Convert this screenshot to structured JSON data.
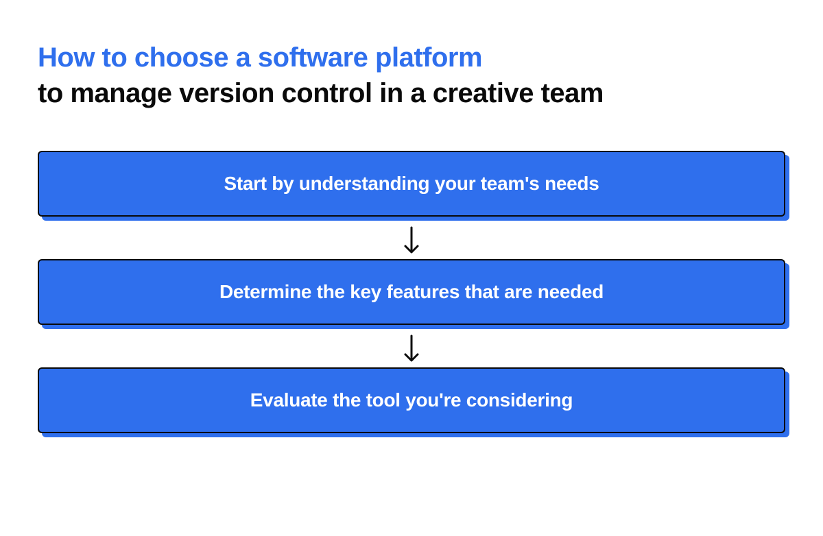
{
  "title": {
    "line1": "How to choose a software platform",
    "line2": "to manage version control in a creative team"
  },
  "steps": [
    {
      "label": "Start by understanding your team's needs"
    },
    {
      "label": "Determine the key features that are needed"
    },
    {
      "label": "Evaluate the tool you're considering"
    }
  ],
  "colors": {
    "accent": "#2F6FED",
    "text_dark": "#0a0a0a",
    "text_light": "#ffffff"
  }
}
